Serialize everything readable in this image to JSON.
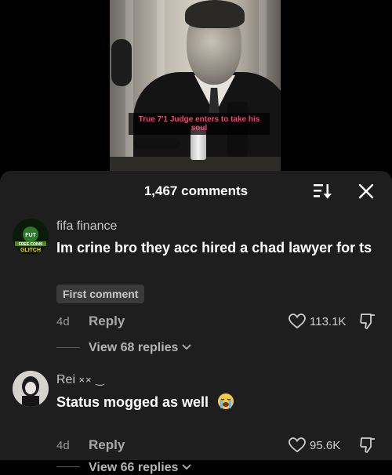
{
  "video": {
    "caption": "True 7'1 Judge enters to take his soul"
  },
  "sheet": {
    "title": "1,467 comments",
    "sort_icon": "sort-icon",
    "close_icon": "close-icon"
  },
  "comments": [
    {
      "username": "fifa finance",
      "avatar_text": {
        "top": "FUT",
        "middle": "FREE COINS",
        "bottom": "GLITCH"
      },
      "text": "Im crine bro they acc hired a chad lawyer for ts",
      "badge": "First comment",
      "age": "4d",
      "reply_label": "Reply",
      "likes": "113.1K",
      "view_replies": "View 68 replies"
    },
    {
      "username": "Rei",
      "username_suffix": "×× ‿",
      "text": "Status mogged as well",
      "emoji": "loudly-crying-face",
      "age": "4d",
      "reply_label": "Reply",
      "likes": "95.6K",
      "view_replies": "View 66 replies"
    }
  ],
  "colors": {
    "sheet_bg": "#1e1e1e",
    "caption": "#ff3d76",
    "badge_bg": "#3a3a3a"
  }
}
